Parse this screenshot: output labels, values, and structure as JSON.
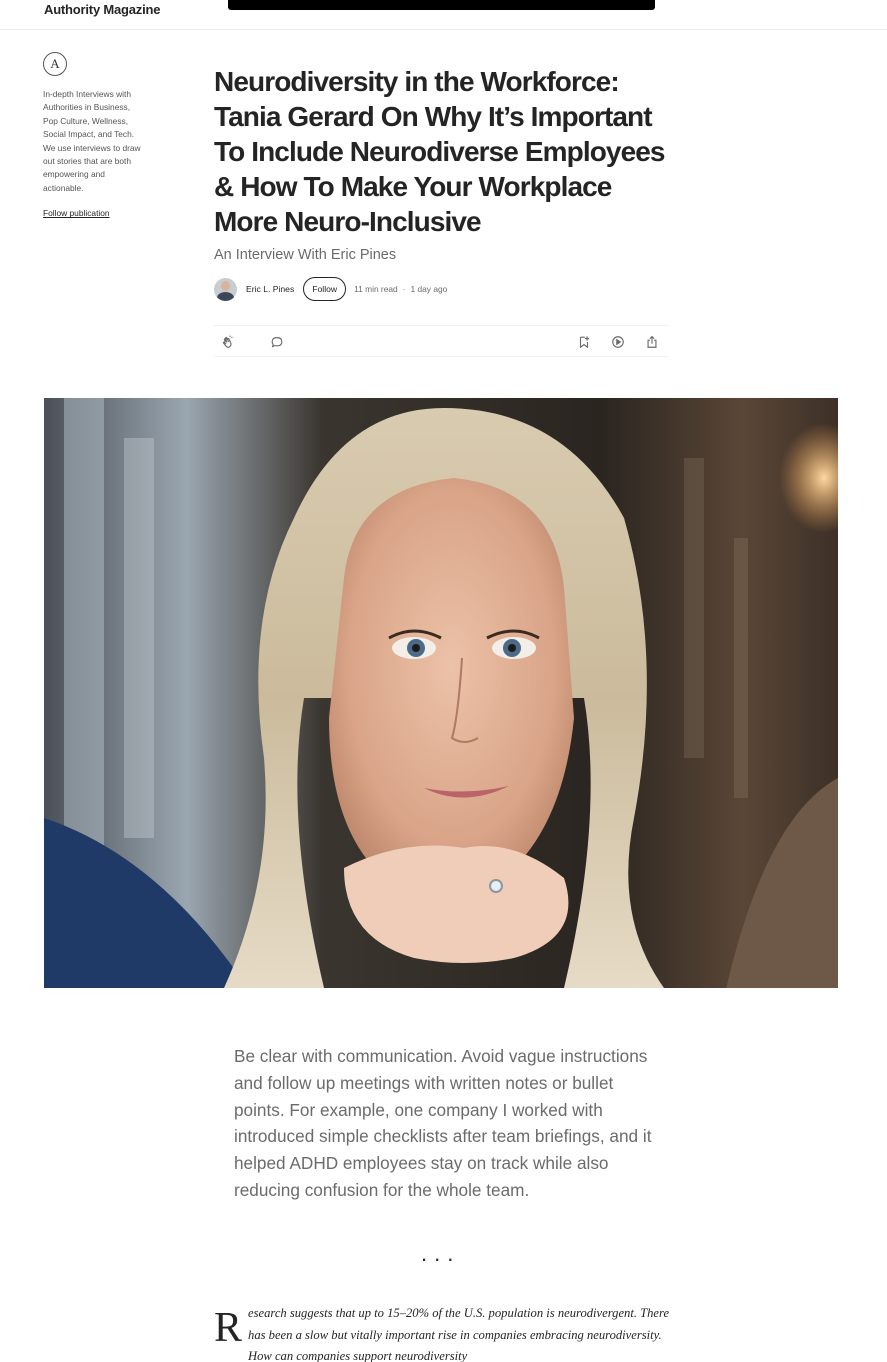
{
  "header": {
    "brand": "Authority Magazine"
  },
  "sidebar": {
    "logo_glyph": "A",
    "description": "In-depth Interviews with Authorities in Business, Pop Culture, Wellness, Social Impact, and Tech. We use interviews to draw out stories that are both empowering and actionable.",
    "follow_label": "Follow publication"
  },
  "article": {
    "title": "Neurodiversity in the Workforce: Tania Gerard On Why It’s Important To Include Neurodiverse Employees & How To Make Your Workplace More Neuro-Inclusive",
    "subtitle": "An Interview With Eric Pines",
    "author": "Eric L. Pines",
    "follow_label": "Follow",
    "read_time": "11 min read",
    "separator": "·",
    "published": "1 day ago",
    "quote": "Be clear with communication. Avoid vague instructions and follow up meetings with written notes or bullet points. For example, one company I worked with introduced simple checklists after team briefings, and it helped ADHD employees stay on track while also reducing confusion for the whole team.",
    "divider": "...",
    "dropcap": "R",
    "body_intro": "esearch suggests that up to 15–20% of the U.S. population is neurodivergent. There has been a slow but vitally important rise in companies embracing neurodiversity. How can companies support neurodiversity"
  },
  "icons": {
    "clap": "clap-icon",
    "comment": "comment-icon",
    "save": "bookmark-add-icon",
    "listen": "play-icon",
    "share": "share-icon"
  },
  "colors": {
    "text": "#242424",
    "muted": "#6b6b6b",
    "divider": "#ededed"
  }
}
